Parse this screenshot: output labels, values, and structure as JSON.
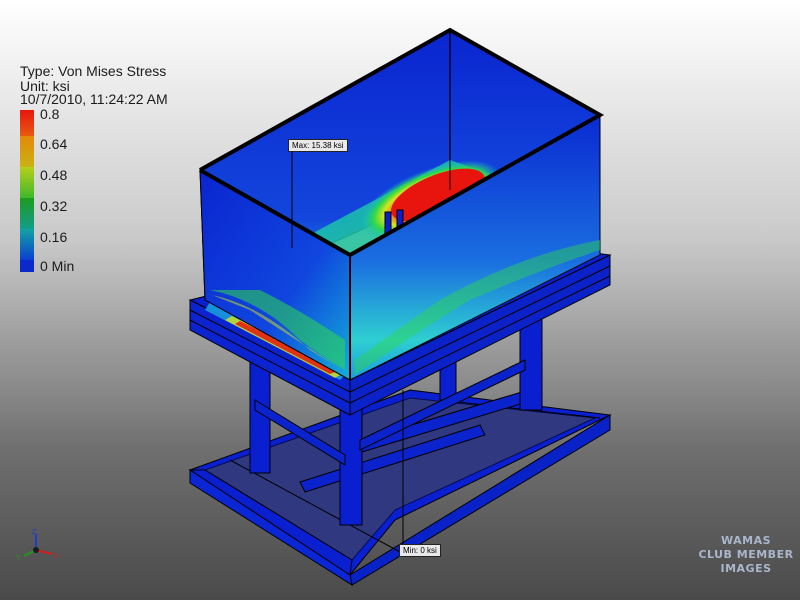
{
  "result_info": {
    "type_line": "Type: Von Mises Stress",
    "unit_line": "Unit: ksi",
    "timestamp": "10/7/2010, 11:24:22 AM"
  },
  "legend": {
    "ticks": [
      "0.8",
      "0.64",
      "0.48",
      "0.32",
      "0.16",
      "0 Min"
    ],
    "colors": [
      "#e8150e",
      "#e28a0a",
      "#b6cf1a",
      "#1e9a1e",
      "#13a3a3",
      "#0a29c8"
    ]
  },
  "probes": {
    "max_label": "Max: 15.38 ksi",
    "min_label": "Min: 0 ksi"
  },
  "watermark": {
    "line1": "WAMAS",
    "line2": "CLUB MEMBER",
    "line3": "IMAGES"
  },
  "triad": {
    "x": "X",
    "y": "Y",
    "z": "Z"
  },
  "colors": {
    "low_stress": "#0a1fd0",
    "mid_low": "#13b8d8",
    "mid": "#2ed84a",
    "mid_high": "#d8e61a",
    "high_stress": "#e8150e"
  }
}
